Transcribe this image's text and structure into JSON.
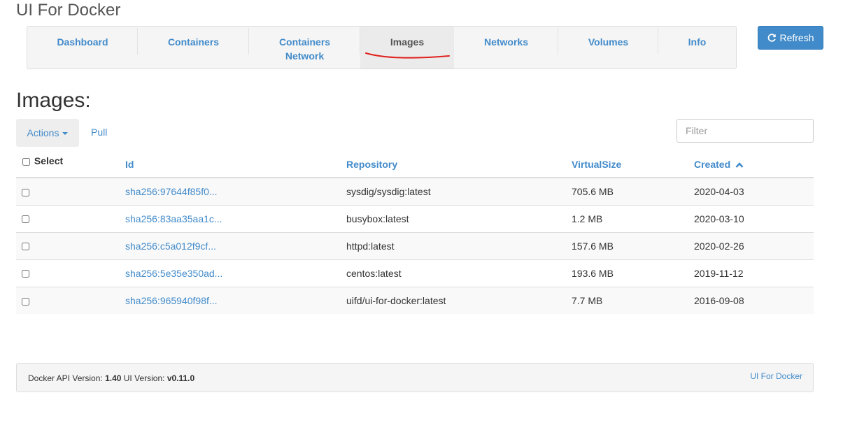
{
  "app": {
    "title": "UI For Docker"
  },
  "nav": {
    "items": [
      {
        "label": "Dashboard"
      },
      {
        "label": "Containers"
      },
      {
        "label": "Containers Network"
      },
      {
        "label": "Images",
        "active": true
      },
      {
        "label": "Networks"
      },
      {
        "label": "Volumes"
      },
      {
        "label": "Info"
      }
    ],
    "refresh_label": "Refresh"
  },
  "page": {
    "heading": "Images:",
    "actions_label": "Actions",
    "pull_label": "Pull",
    "filter_placeholder": "Filter"
  },
  "table": {
    "columns": {
      "select": "Select",
      "id": "Id",
      "repository": "Repository",
      "virtual_size": "VirtualSize",
      "created": "Created"
    },
    "sort": {
      "column": "Created",
      "direction": "ascending"
    },
    "rows": [
      {
        "id": "sha256:97644f85f0...",
        "repository": "sysdig/sysdig:latest",
        "virtual_size": "705.6 MB",
        "created": "2020-04-03"
      },
      {
        "id": "sha256:83aa35aa1c...",
        "repository": "busybox:latest",
        "virtual_size": "1.2 MB",
        "created": "2020-03-10"
      },
      {
        "id": "sha256:c5a012f9cf...",
        "repository": "httpd:latest",
        "virtual_size": "157.6 MB",
        "created": "2020-02-26"
      },
      {
        "id": "sha256:5e35e350ad...",
        "repository": "centos:latest",
        "virtual_size": "193.6 MB",
        "created": "2019-11-12"
      },
      {
        "id": "sha256:965940f98f...",
        "repository": "uifd/ui-for-docker:latest",
        "virtual_size": "7.7 MB",
        "created": "2016-09-08"
      }
    ]
  },
  "footer": {
    "api_label": "Docker API Version:",
    "api_version": "1.40",
    "ui_label": "UI Version:",
    "ui_version": "v0.11.0",
    "brand_link": "UI For Docker"
  },
  "colors": {
    "accent": "#428bca",
    "annotation_underline": "#e0201c"
  },
  "icons": {
    "refresh": "refresh-icon",
    "sort": "chevron-up-icon",
    "dropdown": "caret-down-icon"
  }
}
